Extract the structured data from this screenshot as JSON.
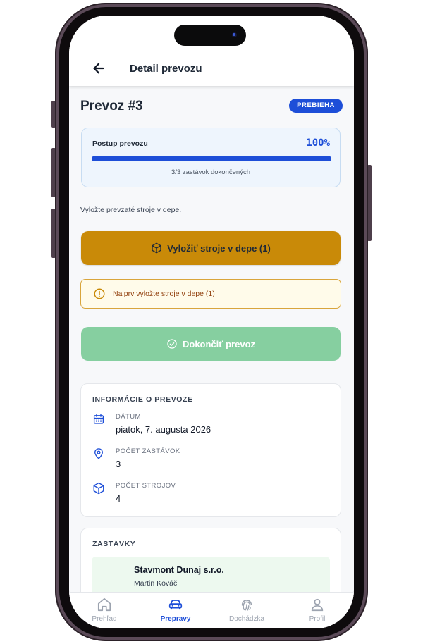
{
  "header": {
    "title": "Detail prevozu",
    "back_icon": "arrow-left-icon"
  },
  "transfer": {
    "title": "Prevoz #3",
    "status": "PREBIEHA",
    "status_color": "#1d4ed8"
  },
  "progress": {
    "label": "Postup prevozu",
    "percent_text": "100%",
    "fraction": 1.0,
    "subtext": "3/3 zastávok dokončených"
  },
  "instruction": "Vyložte prevzaté stroje v depe.",
  "actions": {
    "unload_label": "Vyložiť stroje v depe (1)",
    "unload_icon": "box-icon",
    "unload_color": "#c98a08",
    "warning_text": "Najprv vyložte stroje v depe (1)",
    "warning_icon": "alert-circle-icon",
    "finish_label": "Dokončiť prevoz",
    "finish_icon": "check-circle-icon",
    "finish_color": "#86cfa0"
  },
  "info": {
    "title": "INFORMÁCIE O PREVOZE",
    "rows": [
      {
        "icon": "calendar-icon",
        "label": "DÁTUM",
        "value": "piatok, 7. augusta 2026"
      },
      {
        "icon": "map-pin-icon",
        "label": "POČET ZASTÁVOK",
        "value": "3"
      },
      {
        "icon": "box-icon",
        "label": "POČET STROJOV",
        "value": "4"
      }
    ]
  },
  "stops": {
    "title": "ZASTÁVKY",
    "items": [
      {
        "name": "Stavmont Dunaj s.r.o.",
        "person": "Martin Kováč"
      }
    ]
  },
  "nav": {
    "items": [
      {
        "label": "Prehľad",
        "icon": "home-icon",
        "active": false
      },
      {
        "label": "Prepravy",
        "icon": "car-icon",
        "active": true
      },
      {
        "label": "Dochádzka",
        "icon": "fingerprint-icon",
        "active": false
      },
      {
        "label": "Profil",
        "icon": "user-icon",
        "active": false
      }
    ]
  }
}
